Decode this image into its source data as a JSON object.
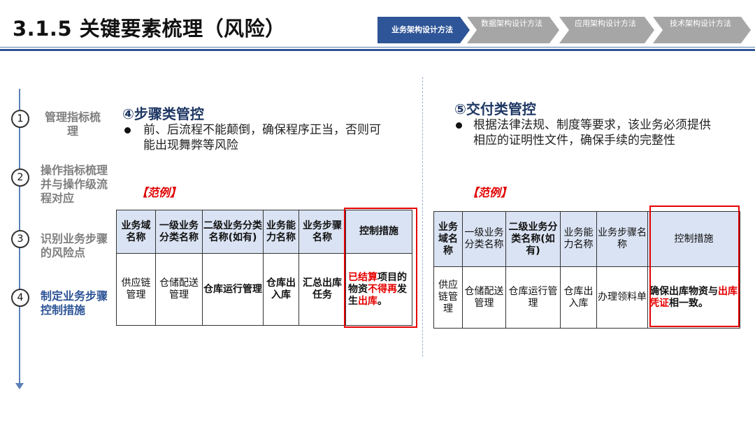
{
  "header": {
    "title": "3.1.5 关键要素梳理（风险）",
    "crumbs": [
      {
        "label": "业务架构设计方法",
        "active": true
      },
      {
        "label": "数据架构设计方法",
        "active": false
      },
      {
        "label": "应用架构设计方法",
        "active": false
      },
      {
        "label": "技术架构设计方法",
        "active": false
      }
    ]
  },
  "steps": [
    {
      "num": "1",
      "label": "管理指标梳理"
    },
    {
      "num": "2",
      "label": "操作指标梳理并与操作级流程对应"
    },
    {
      "num": "3",
      "label": "识别业务步骤的风险点"
    },
    {
      "num": "4",
      "label": "制定业务步骤控制措施"
    }
  ],
  "left": {
    "title": "④步骤类管控",
    "bullet": "前、后流程不能颠倒，确保程序正当，否则可能出现舞弊等风险",
    "example": "【范例】",
    "headers": [
      "业务域名称",
      "一级业务分类名称",
      "二级业务分类名称(如有)",
      "业务能力名称",
      "业务步骤名称",
      "控制措施"
    ],
    "row": [
      "供应链管理",
      "仓储配送管理",
      "仓库运行管理",
      "仓库出入库",
      "汇总出库任务"
    ],
    "control": {
      "p1": "已结算",
      "p2": "项目的物资",
      "p3": "不得再",
      "p4": "发生",
      "p5": "出库",
      "p6": "。"
    }
  },
  "right": {
    "title": "⑤交付类管控",
    "bullet": "根据法律法规、制度等要求，该业务必须提供相应的证明性文件，确保手续的完整性",
    "example": "【范例】",
    "headers": [
      "业务域名称",
      "一级业务分类名称",
      "二级业务分类名称(如有)",
      "业务能力名称",
      "业务步骤名称",
      "控制措施"
    ],
    "row": [
      "供应链管理",
      "仓储配送管理",
      "仓库运行管理",
      "仓库出入库",
      "办理领料单"
    ],
    "control": {
      "p1": "确保出库物资与",
      "p2": "出库凭证",
      "p3": "相一致。"
    }
  },
  "colors": {
    "accent": "#2e5597",
    "highlight": "#e60000",
    "header_fill": "#dae3f3"
  }
}
